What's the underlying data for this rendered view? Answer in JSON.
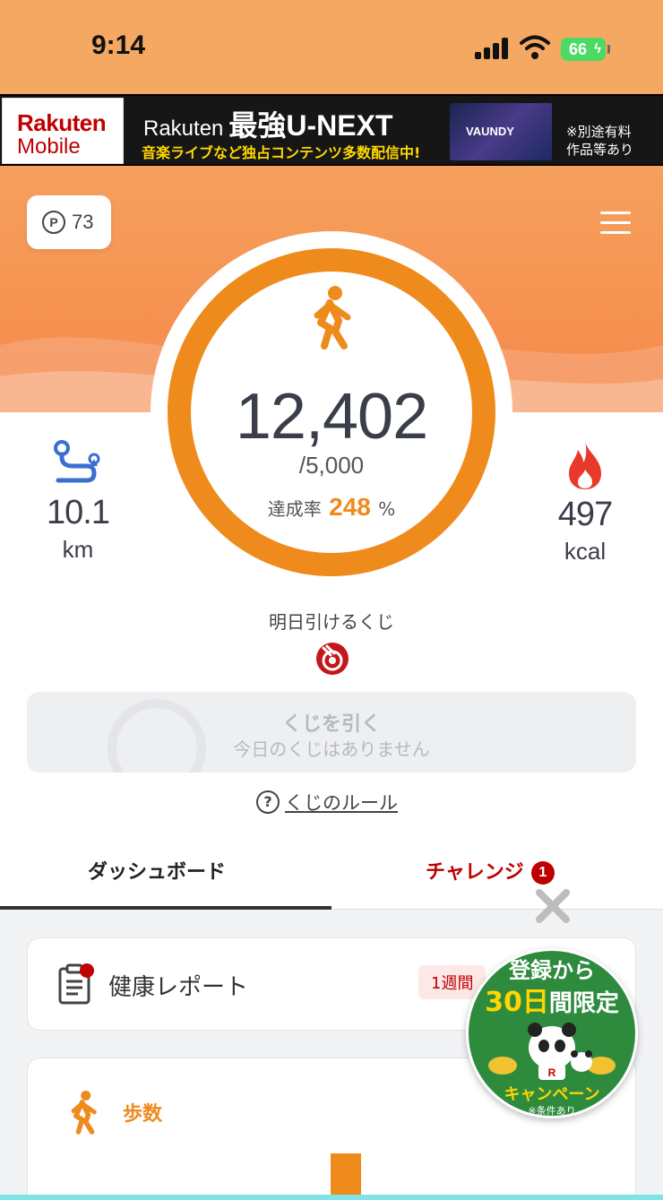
{
  "status": {
    "time": "9:14",
    "battery": "66"
  },
  "ad": {
    "logo_line1": "Rakuten",
    "logo_line2": "Mobile",
    "brand": "Rakuten",
    "title": "最強U-NEXT",
    "subtitle": "音楽ライブなど独占コンテンツ多数配信中!",
    "image_text": "VAUNDY",
    "note_line1": "※別途有料",
    "note_line2": "作品等あり"
  },
  "header": {
    "points": "73",
    "points_icon": "P"
  },
  "steps": {
    "value": "12,402",
    "goal": "/5,000",
    "rate_label": "達成率",
    "rate_value": "248",
    "rate_unit": "%",
    "progress": 1.0
  },
  "distance": {
    "value": "10.1",
    "unit": "km"
  },
  "calories": {
    "value": "497",
    "unit": "kcal"
  },
  "lottery": {
    "label": "明日引けるくじ",
    "button_title": "くじを引く",
    "button_sub": "今日のくじはありません",
    "rules_icon": "?",
    "rules_link": "くじのルール"
  },
  "tabs": [
    {
      "label": "ダッシュボード",
      "active": true
    },
    {
      "label": "チャレンジ",
      "badge": "1"
    }
  ],
  "cards": {
    "report_title": "健康レポート",
    "report_pill": "1週間",
    "steps_title": "歩数"
  },
  "promo": {
    "line1": "登録から",
    "line2_highlight": "30日",
    "line2_rest": "間限定",
    "line3": "キャンペーン",
    "line4": "※条件あり"
  },
  "colors": {
    "accent": "#ef8a1c",
    "brand_red": "#bf0000",
    "header_orange": "#f5a862"
  },
  "icons": [
    "walk-icon",
    "route-icon",
    "flame-icon",
    "lottery-icon",
    "menu-icon",
    "report-icon",
    "close-icon"
  ]
}
